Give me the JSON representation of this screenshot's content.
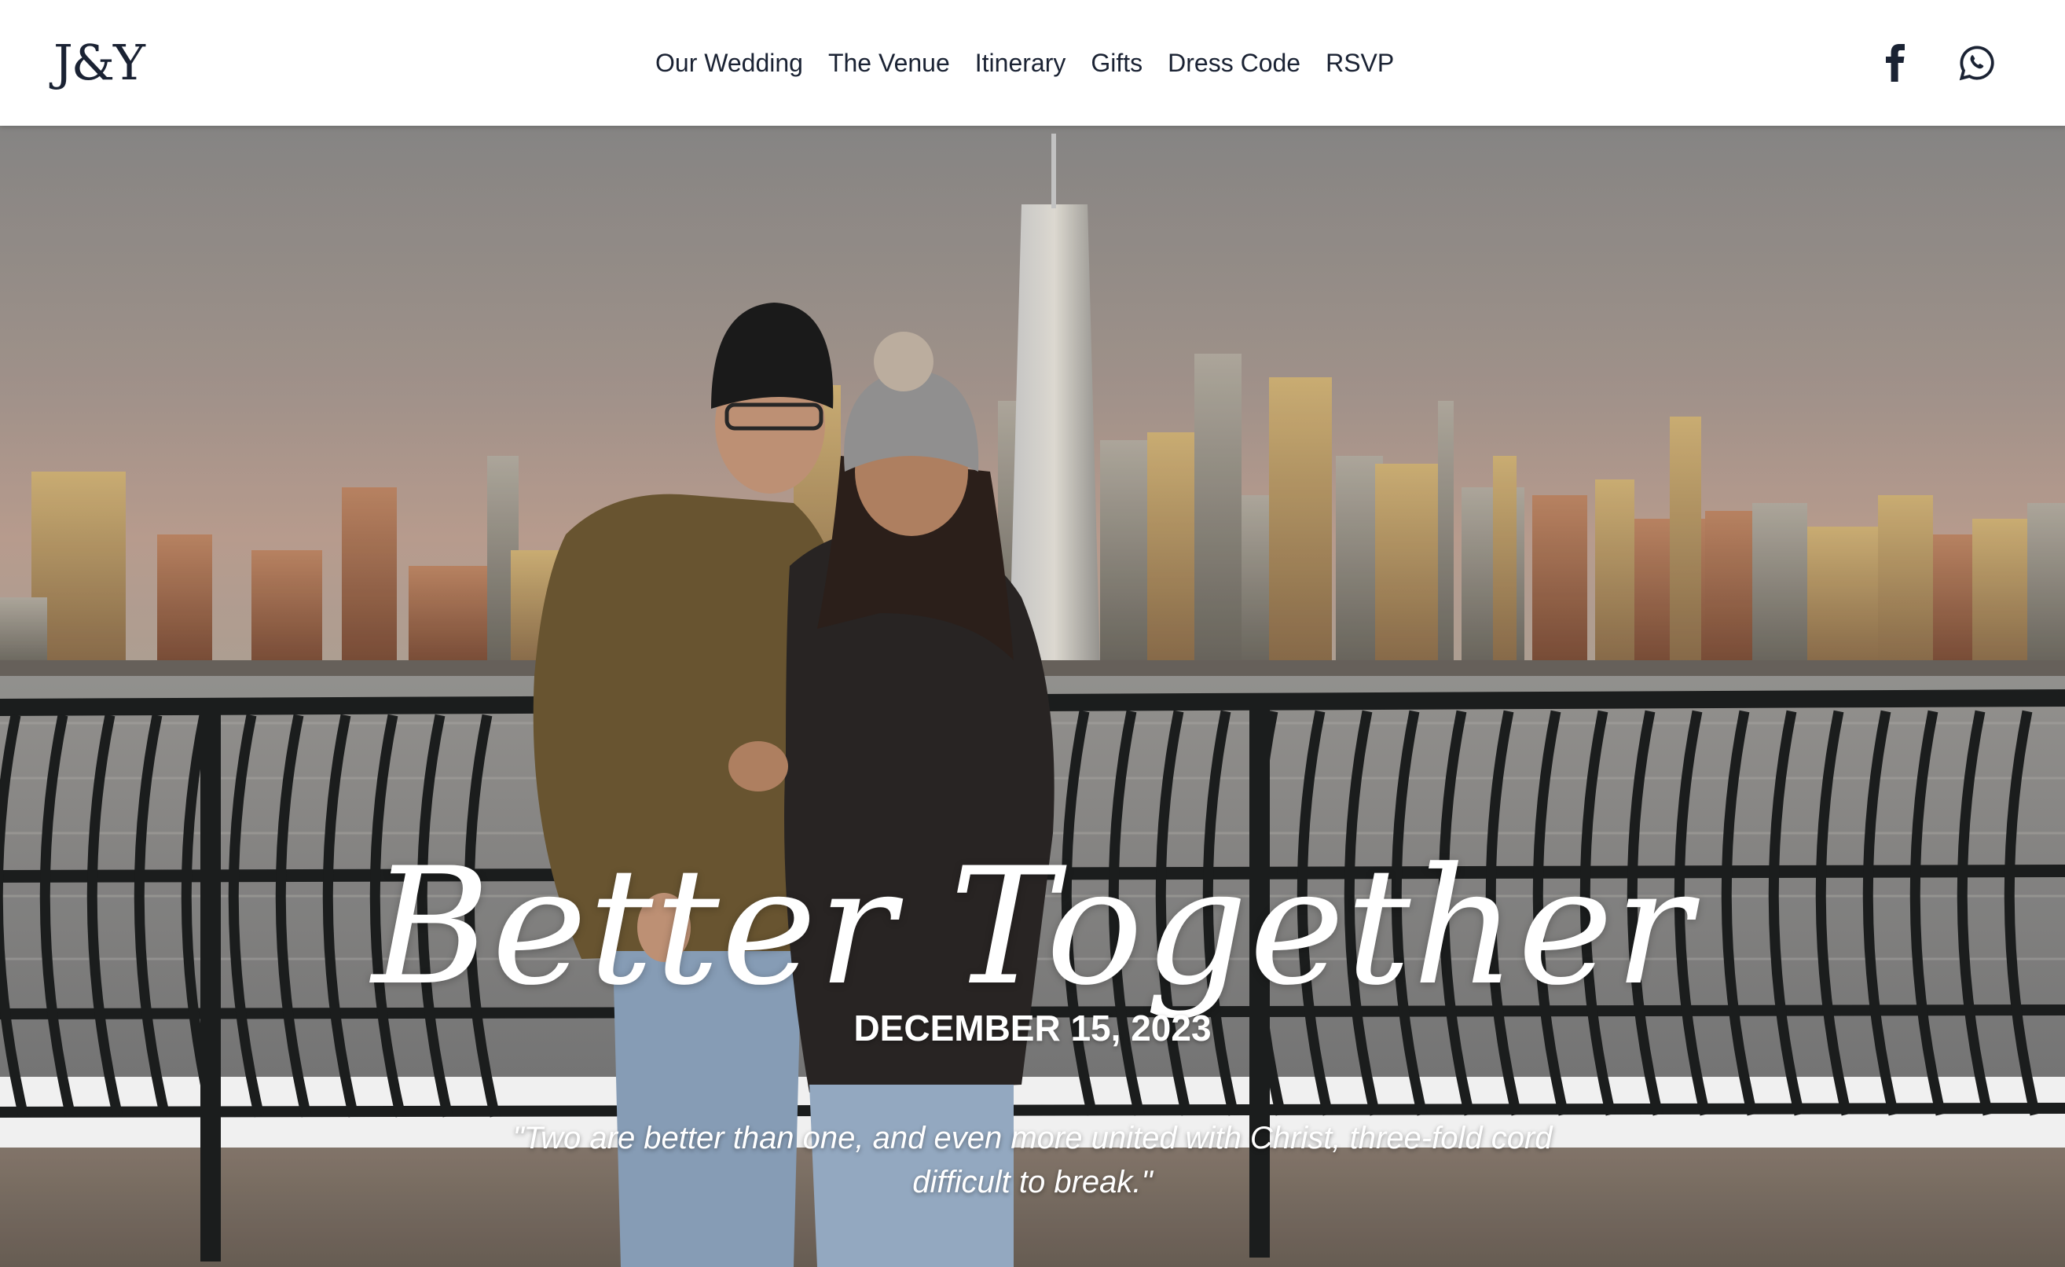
{
  "header": {
    "logo": "J&Y",
    "nav": [
      {
        "label": "Our Wedding"
      },
      {
        "label": "The Venue"
      },
      {
        "label": "Itinerary"
      },
      {
        "label": "Gifts"
      },
      {
        "label": "Dress Code"
      },
      {
        "label": "RSVP"
      }
    ],
    "social": [
      {
        "icon": "facebook-icon"
      },
      {
        "icon": "whatsapp-icon"
      }
    ]
  },
  "hero": {
    "title": "Better Together",
    "date": "DECEMBER 15, 2023",
    "quote": "\"Two are better than one, and even more united with Christ, three-fold cord difficult to break.\""
  },
  "colors": {
    "header_bg": "#ffffff",
    "header_text": "#1a2233",
    "hero_text": "#ffffff"
  }
}
